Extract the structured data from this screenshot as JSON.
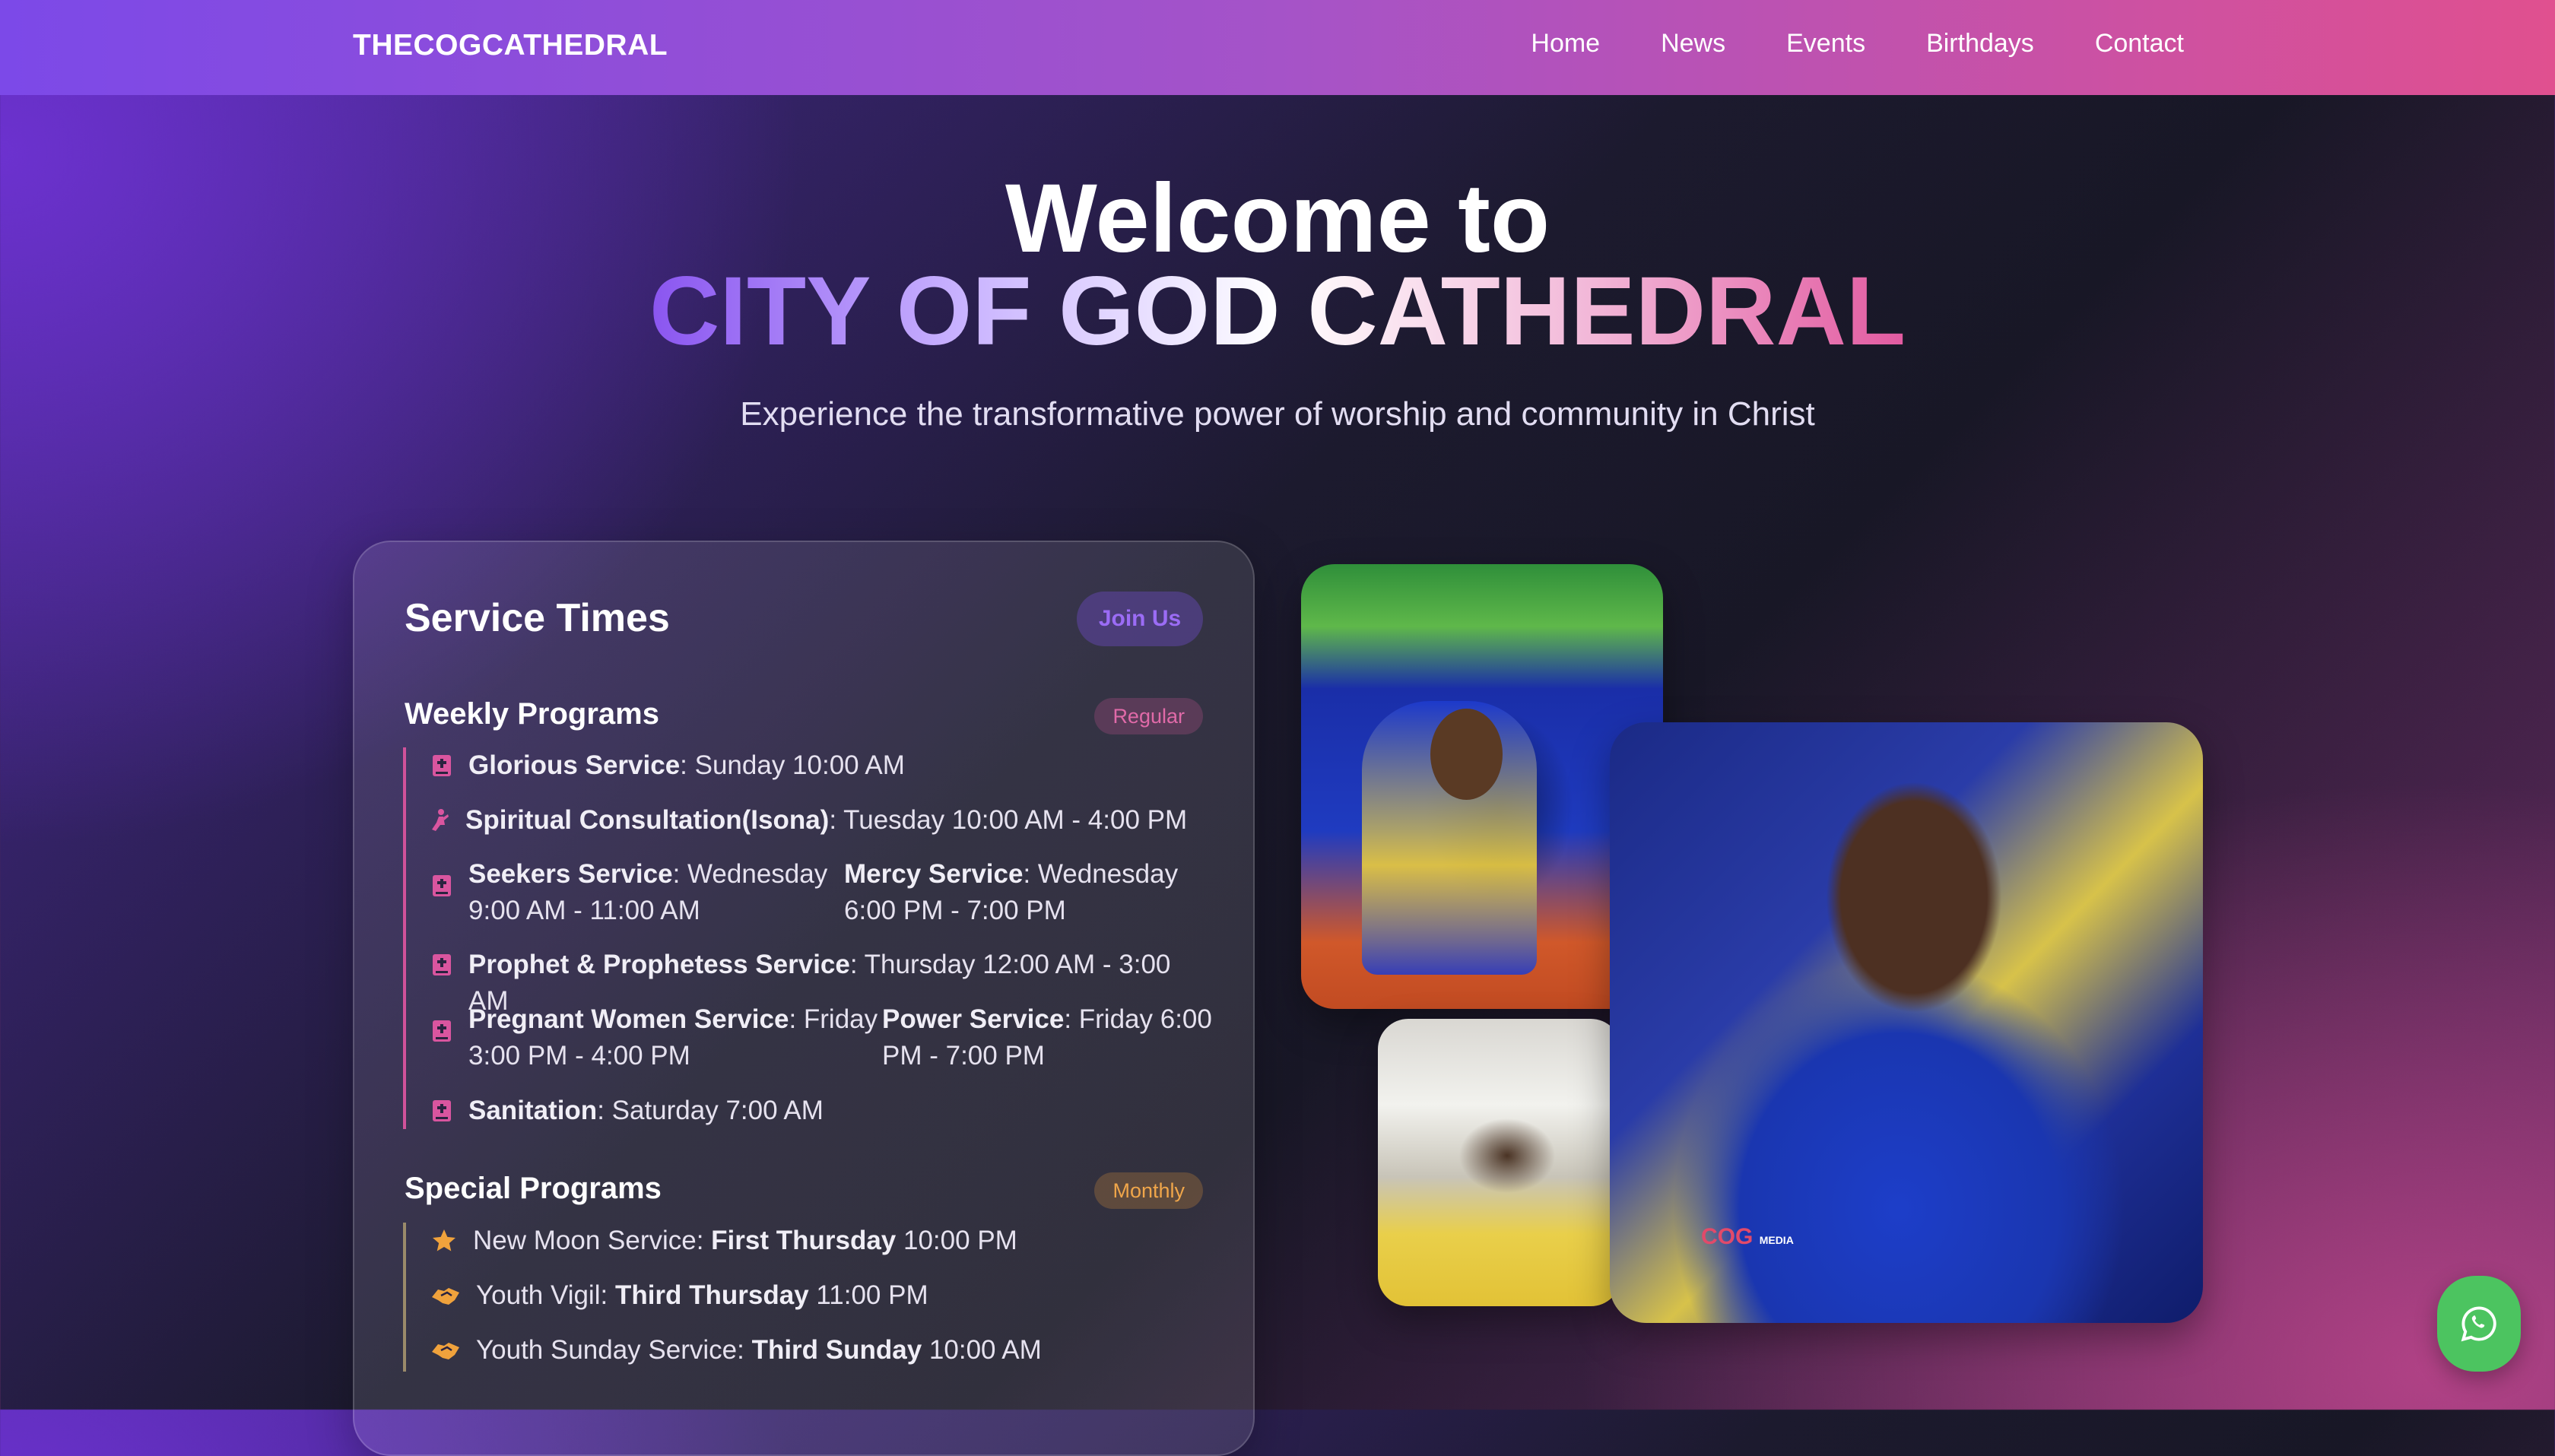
{
  "nav": {
    "brand": "THECOGCATHEDRAL",
    "links": [
      "Home",
      "News",
      "Events",
      "Birthdays",
      "Contact"
    ]
  },
  "hero": {
    "title_line1": "Welcome to",
    "title_line2": "CITY OF GOD CATHEDRAL",
    "subtitle": "Experience the transformative power of worship and community in Christ"
  },
  "service_card": {
    "title": "Service Times",
    "join_label": "Join Us",
    "weekly": {
      "title": "Weekly Programs",
      "badge": "Regular",
      "items": [
        {
          "icon": "bible-icon",
          "name": "Glorious Service",
          "time": ": Sunday 10:00 AM"
        },
        {
          "icon": "praying-person-icon",
          "name": "Spiritual Consultation(Isona)",
          "time": ": Tuesday 10:00 AM - 4:00 PM"
        },
        {
          "icon": "bible-icon",
          "name": "Seekers Service",
          "time": ": Wednesday 9:00 AM - 11:00 AM",
          "name2": "Mercy Service",
          "time2": ": Wednesday 6:00 PM - 7:00 PM"
        },
        {
          "icon": "bible-icon",
          "name": "Prophet & Prophetess Service",
          "time": ": Thursday 12:00 AM - 3:00 AM"
        },
        {
          "icon": "bible-icon",
          "name": "Pregnant Women Service",
          "time": ": Friday 3:00 PM - 4:00 PM",
          "name2": "Power Service",
          "time2": ": Friday 6:00 PM - 7:00 PM"
        },
        {
          "icon": "bible-icon",
          "name": "Sanitation",
          "time": ": Saturday 7:00 AM"
        }
      ]
    },
    "special": {
      "title": "Special Programs",
      "badge": "Monthly",
      "items": [
        {
          "icon": "star-icon",
          "prefix": "New Moon Service: ",
          "bold": "First Thursday",
          "suffix": " 10:00 PM"
        },
        {
          "icon": "handshake-icon",
          "prefix": "Youth Vigil: ",
          "bold": "Third Thursday",
          "suffix": " 11:00 PM"
        },
        {
          "icon": "handshake-icon",
          "prefix": "Youth Sunday Service: ",
          "bold": "Third Sunday",
          "suffix": " 10:00 AM"
        }
      ]
    }
  },
  "images": {
    "logo_text_a": "COG",
    "logo_text_b": "MEDIA"
  },
  "colors": {
    "accent_purple": "#7c49e8",
    "accent_pink": "#e0508f",
    "whatsapp_green": "#4cc460"
  }
}
